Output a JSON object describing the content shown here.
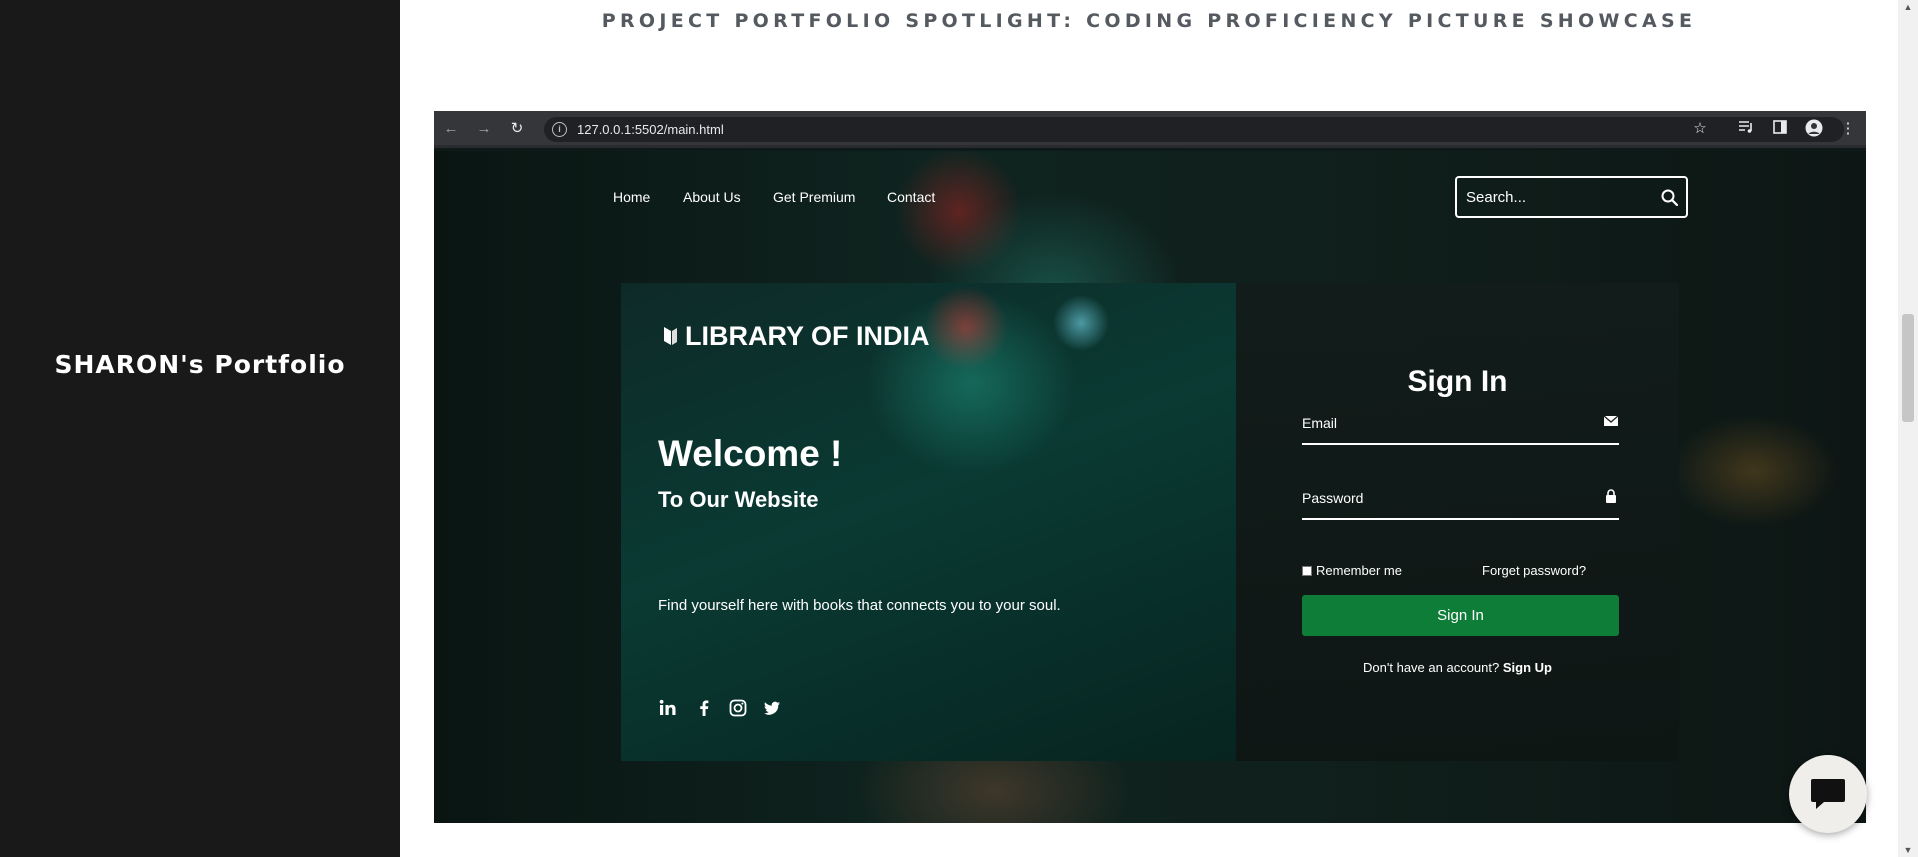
{
  "sidebar": {
    "title": "SHARON's Portfolio"
  },
  "main": {
    "heading": "PROJECT PORTFOLIO SPOTLIGHT: CODING PROFICIENCY PICTURE SHOWCASE"
  },
  "screenshot": {
    "browser": {
      "url": "127.0.0.1:5502/main.html",
      "icons": [
        "back-arrow-icon",
        "forward-arrow-icon",
        "reload-icon",
        "site-info-icon",
        "star-icon",
        "media-control-icon",
        "side-panel-icon",
        "profile-avatar-icon",
        "kebab-menu-icon"
      ]
    },
    "site": {
      "nav": [
        "Home",
        "About Us",
        "Get Premium",
        "Contact"
      ],
      "search_placeholder": "Search...",
      "brand": "LIBRARY OF INDIA",
      "welcome_title": "Welcome !",
      "welcome_subtitle": "To Our Website",
      "tagline": "Find yourself here with books that connects you to your soul.",
      "socials": [
        "linkedin-icon",
        "facebook-icon",
        "instagram-icon",
        "twitter-icon"
      ],
      "signin": {
        "title": "Sign In",
        "email_label": "Email",
        "password_label": "Password",
        "remember_label": "Remember me",
        "forgot_label": "Forget password?",
        "button_label": "Sign In",
        "signup_prompt": "Don't have an account?",
        "signup_link": "Sign Up"
      }
    }
  },
  "colors": {
    "sidebar_bg": "#191919",
    "heading": "#555a60",
    "signin_button": "#0e7d38"
  }
}
